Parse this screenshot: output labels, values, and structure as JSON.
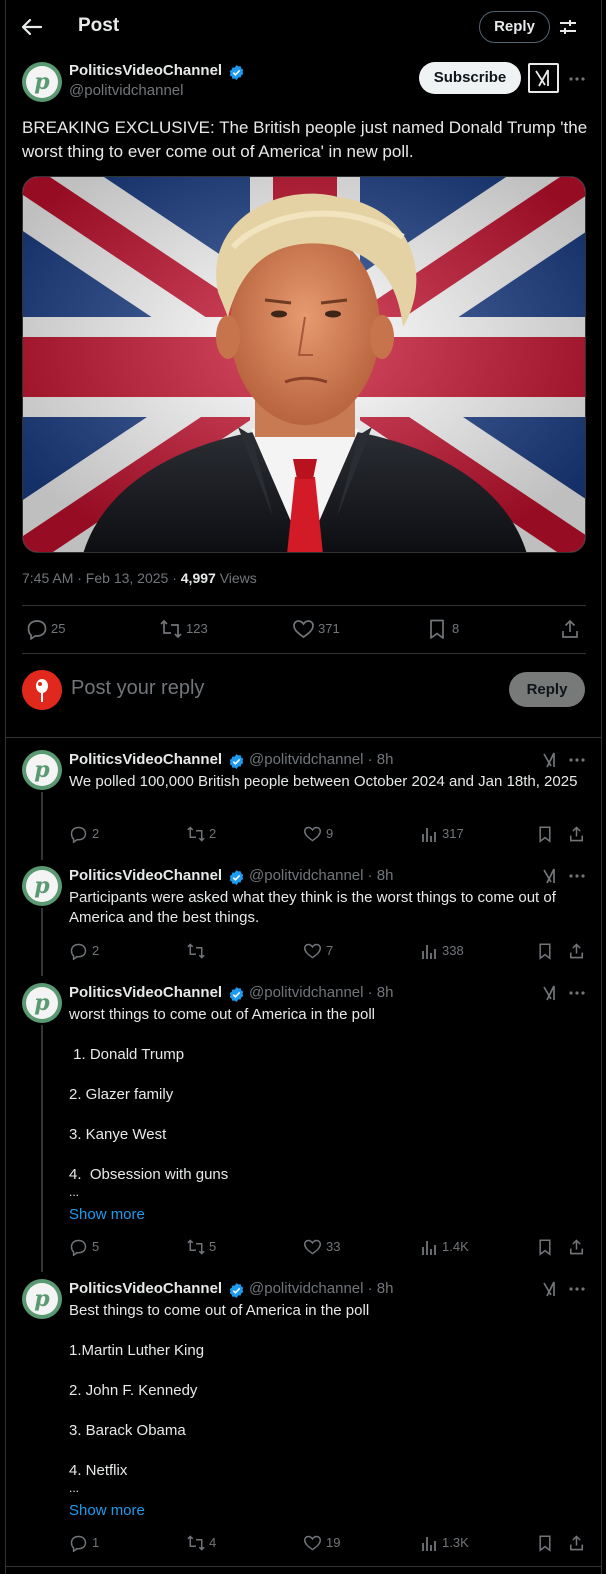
{
  "header": {
    "title": "Post",
    "reply_label": "Reply"
  },
  "main_post": {
    "author_name": "PoliticsVideoChannel",
    "author_handle": "@politvidchannel",
    "subscribe_label": "Subscribe",
    "text": "BREAKING EXCLUSIVE: The British people just named Donald Trump 'the worst thing to ever come out of America' in new poll.",
    "time": "7:45 AM · Feb 13, 2025 · ",
    "views_count": "4,997",
    "views_label": " Views",
    "stats": {
      "replies": "25",
      "reposts": "123",
      "likes": "371",
      "bookmarks": "8"
    }
  },
  "compose": {
    "placeholder": "Post your reply",
    "reply_label": "Reply"
  },
  "replies": [
    {
      "name": "PoliticsVideoChannel",
      "handle": "@politvidchannel · 8h",
      "text": "We polled 100,000 British people between October 2024 and Jan 18th, 2025",
      "stats": {
        "replies": "2",
        "reposts": "2",
        "likes": "9",
        "views": "317"
      }
    },
    {
      "name": "PoliticsVideoChannel",
      "handle": "@politvidchannel · 8h",
      "text": "Participants were asked what they think is the worst things to come out of America and the best things.",
      "stats": {
        "replies": "2",
        "reposts": "",
        "likes": "7",
        "views": "338"
      }
    },
    {
      "name": "PoliticsVideoChannel",
      "handle": "@politvidchannel · 8h",
      "lines": [
        "worst things to come out of America in the poll",
        " 1. Donald Trump",
        "2. Glazer family",
        "3. Kanye West",
        "4.  Obsession with guns",
        "..."
      ],
      "show_more": "Show more",
      "stats": {
        "replies": "5",
        "reposts": "5",
        "likes": "33",
        "views": "1.4K"
      }
    },
    {
      "name": "PoliticsVideoChannel",
      "handle": "@politvidchannel · 8h",
      "lines": [
        "Best things to come out of America in the poll",
        "1.Martin Luther King",
        "2. John F. Kennedy",
        "3. Barack Obama",
        "4. Netflix",
        "..."
      ],
      "show_more": "Show more",
      "stats": {
        "replies": "1",
        "reposts": "4",
        "likes": "19",
        "views": "1.3K"
      }
    }
  ],
  "colors": {
    "accent": "#1d9bf0",
    "background": "#000000",
    "muted": "#71767b",
    "text": "#e7e9ea",
    "avatar": "#5a9a72"
  },
  "icons": [
    "back-arrow-icon",
    "tune-icon",
    "verified-badge-icon",
    "grok-icon",
    "more-icon",
    "reply-icon",
    "repost-icon",
    "like-icon",
    "bookmark-icon",
    "share-icon",
    "views-icon"
  ]
}
